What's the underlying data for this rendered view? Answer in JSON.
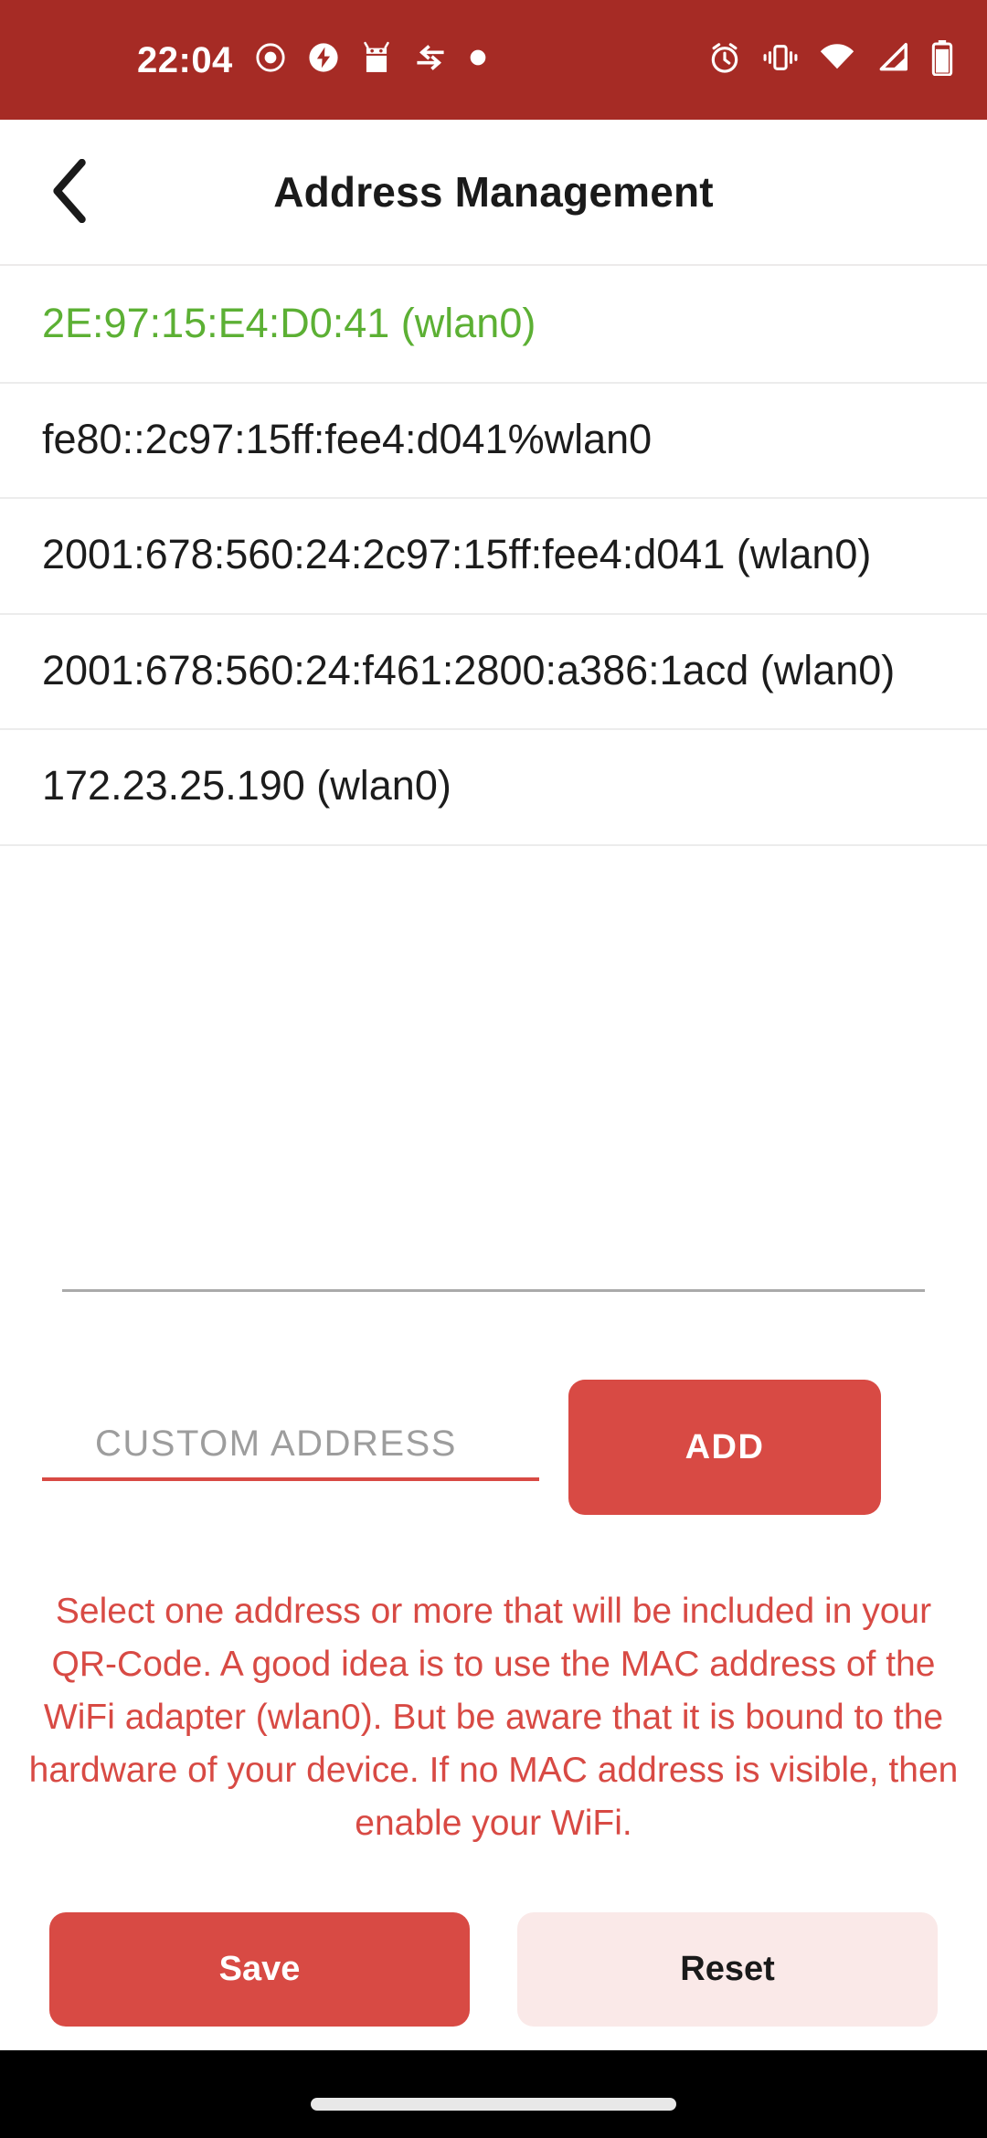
{
  "status_bar": {
    "time": "22:04",
    "background_color": "#a62b25",
    "left_icons": [
      "record-dot-icon",
      "flash-bolt-icon",
      "android-robot-icon",
      "data-transfer-icon",
      "dot-icon"
    ],
    "right_icons": [
      "alarm-clock-icon",
      "vibrate-icon",
      "wifi-icon",
      "cellular-signal-icon",
      "battery-icon"
    ]
  },
  "appbar": {
    "back_icon": "chevron-left-icon",
    "title": "Address Management"
  },
  "addresses": [
    {
      "text": "2E:97:15:E4:D0:41 (wlan0)",
      "selected": true
    },
    {
      "text": "fe80::2c97:15ff:fee4:d041%wlan0",
      "selected": false
    },
    {
      "text": "2001:678:560:24:2c97:15ff:fee4:d041 (wlan0)",
      "selected": false
    },
    {
      "text": "2001:678:560:24:f461:2800:a386:1acd (wlan0)",
      "selected": false
    },
    {
      "text": "172.23.25.190 (wlan0)",
      "selected": false
    }
  ],
  "custom_address": {
    "placeholder": "CUSTOM ADDRESS",
    "value": "",
    "add_label": "ADD"
  },
  "description": "Select one address or more that will be included in your QR-Code. A good idea is to use the MAC address of the WiFi adapter (wlan0). But be aware that it is bound to the hardware of your device. If no MAC address is visible, then enable your WiFi.",
  "actions": {
    "save_label": "Save",
    "reset_label": "Reset"
  },
  "colors": {
    "status_bar_red": "#a62b25",
    "accent_red": "#d84a44",
    "selected_green": "#5cb034",
    "reset_bg": "#fae9e8"
  }
}
